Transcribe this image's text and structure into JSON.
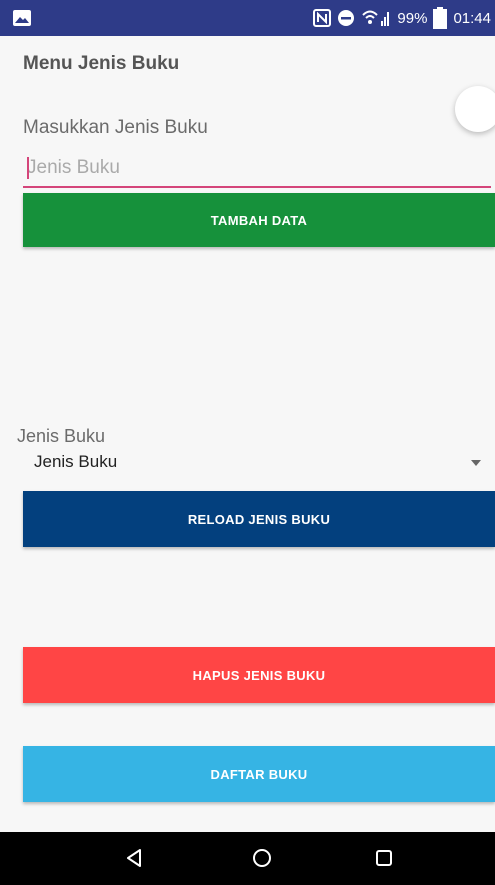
{
  "status_bar": {
    "battery_percent": "99%",
    "time": "01:44",
    "icons": [
      "image-icon",
      "nfc-icon",
      "do-not-disturb-icon",
      "wifi-icon",
      "signal-icon",
      "battery-icon"
    ]
  },
  "header": {
    "title": "Menu Jenis Buku"
  },
  "form": {
    "input_label": "Masukkan Jenis Buku",
    "input_placeholder": "Jenis Buku",
    "input_value": "",
    "add_button": "TAMBAH DATA"
  },
  "spinner": {
    "label": "Jenis Buku",
    "selected": "Jenis Buku"
  },
  "buttons": {
    "reload": "RELOAD JENIS BUKU",
    "delete": "HAPUS JENIS BUKU",
    "list": "DAFTAR BUKU"
  },
  "colors": {
    "status_bar": "#2e3b88",
    "add": "#16913b",
    "reload": "#03407e",
    "delete": "#ff4545",
    "list": "#36b4e4",
    "accent": "#d4457a"
  },
  "nav_bar": {
    "icons": [
      "back-icon",
      "home-icon",
      "recents-icon"
    ]
  }
}
